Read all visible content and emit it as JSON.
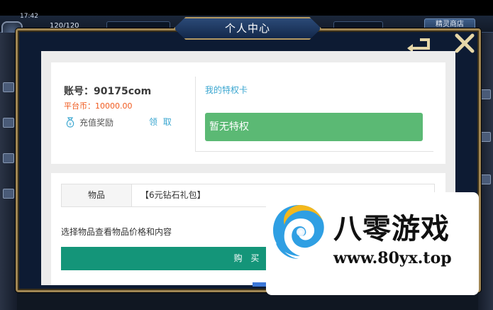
{
  "status": {
    "time": "17:42",
    "hp": "120/120"
  },
  "header": {
    "shop_label": "精灵商店"
  },
  "dialog": {
    "title": "个人中心"
  },
  "account": {
    "label": "账号：90175com",
    "balance": "平台币：10000.00",
    "recharge_label": "充值奖励",
    "claim_label": "领 取"
  },
  "privilege": {
    "title": "我的特权卡",
    "status": "暂无特权"
  },
  "purchase": {
    "item_label": "物品",
    "item_value": "【6元钻石礼包】",
    "hint": "选择物品查看物品价格和内容",
    "buy_label": "购 买"
  },
  "watermark": {
    "title": "八零游戏",
    "url": "www.80yx.top"
  },
  "colors": {
    "accent_blue": "#3aa6d0",
    "balance_orange": "#f05a1e",
    "privilege_green": "#5bb974",
    "buy_teal": "#149579",
    "frame_gold": "#a08654"
  }
}
